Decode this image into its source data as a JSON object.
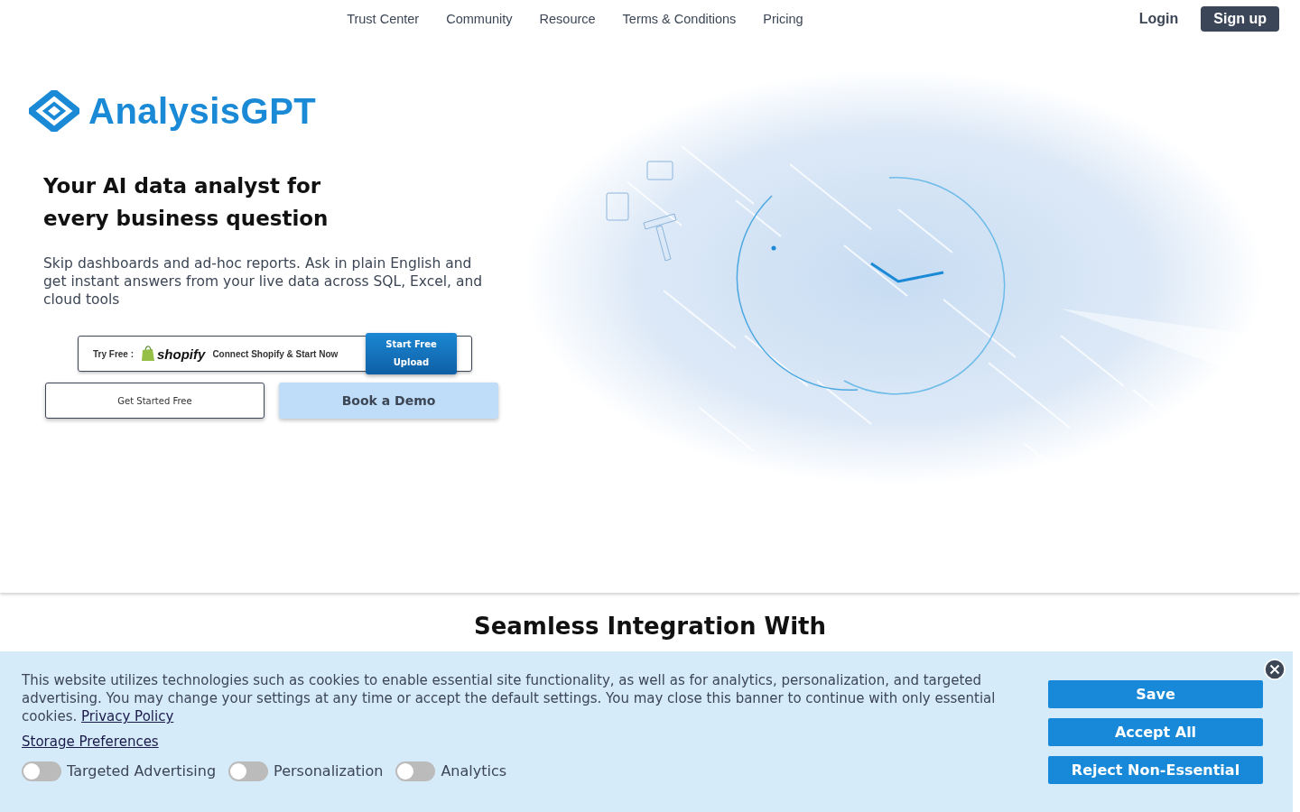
{
  "nav": {
    "links": [
      "Trust Center",
      "Community",
      "Resource",
      "Terms & Conditions",
      "Pricing"
    ],
    "login": "Login",
    "signup": "Sign up"
  },
  "hero": {
    "brand": "AnalysisGPT",
    "headline": "Your AI data analyst for every business question",
    "subtext": "Skip dashboards and ad-hoc reports. Ask in plain English and get instant answers from your live data across SQL, Excel, and cloud tools",
    "shopify_bar": {
      "prefix": "Try Free :",
      "logo_text": "shopify",
      "cta": "Connect Shopify & Start Now",
      "upload_button": "Start Free Upload"
    },
    "buttons": [
      {
        "kind": "outline",
        "label": "Get Started Free"
      },
      {
        "kind": "filled",
        "label": "Book a Demo"
      }
    ]
  },
  "section_heading": "Seamless Integration With",
  "cookie_banner": {
    "text": "This website utilizes technologies such as cookies to enable essential site functionality, as well as for analytics, personalization, and targeted advertising. You may change your settings at any time or accept the default settings. You may close this banner to continue with only essential cookies.",
    "privacy_link": "Privacy Policy",
    "preferences_link": "Storage Preferences",
    "toggles": [
      {
        "label": "Targeted Advertising",
        "checked": false
      },
      {
        "label": "Personalization",
        "checked": false
      },
      {
        "label": "Analytics",
        "checked": false
      }
    ],
    "buttons": [
      "Save",
      "Accept All",
      "Reject Non-Essential"
    ]
  }
}
